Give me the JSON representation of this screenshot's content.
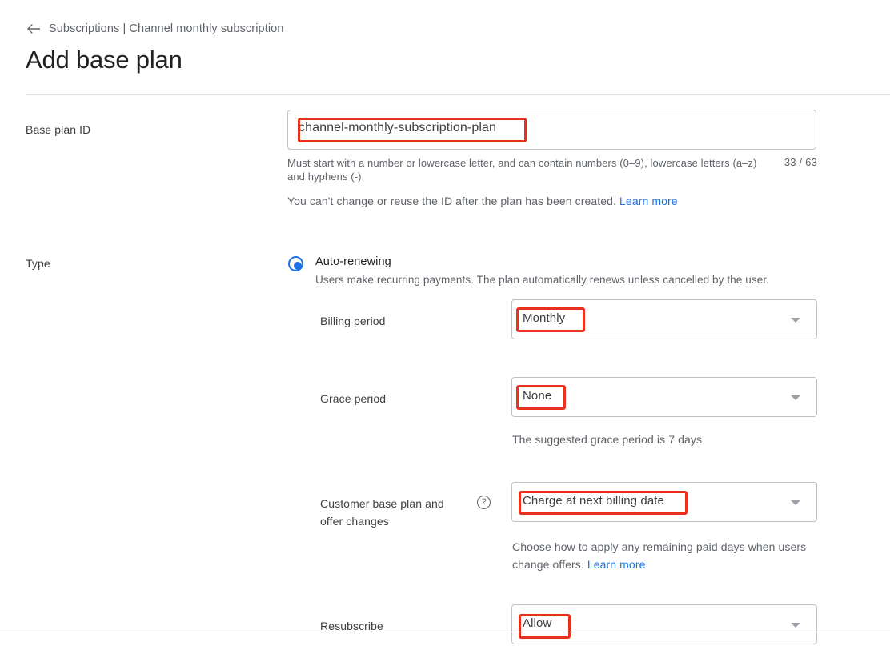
{
  "header": {
    "back_icon": "arrow-left-icon",
    "breadcrumb": "Subscriptions | Channel monthly subscription",
    "title": "Add base plan"
  },
  "form": {
    "base_plan_id": {
      "label": "Base plan ID",
      "value": "channel-monthly-subscription-plan",
      "placeholder": "",
      "helper": "Must start with a number or lowercase letter, and can contain numbers (0–9), lowercase letters (a–z) and hyphens (-)",
      "counter": "33 / 63",
      "note": "You can't change or reuse the ID after the plan has been created.",
      "note_link": "Learn more"
    },
    "type": {
      "label": "Type",
      "radio": {
        "icon": "radio-selected-icon",
        "title": "Auto-renewing",
        "description": "Users make recurring payments. The plan automatically renews unless cancelled by the user.",
        "checked": true
      }
    },
    "billing_period": {
      "label": "Billing period",
      "value": "Monthly",
      "arrow_icon": "chevron-down-icon"
    },
    "grace_period": {
      "label": "Grace period",
      "value": "None",
      "arrow_icon": "chevron-down-icon",
      "helper": "The suggested grace period is 7 days"
    },
    "customer_changes": {
      "label": "Customer base plan and offer changes",
      "help_icon": "help-circle-icon",
      "help_glyph": "?",
      "value": "Charge at next billing date",
      "arrow_icon": "chevron-down-icon",
      "helper": "Choose how to apply any remaining paid days when users change offers.",
      "helper_link": "Learn more"
    },
    "resubscribe": {
      "label": "Resubscribe",
      "value": "Allow",
      "arrow_icon": "chevron-down-icon"
    }
  },
  "annotations": {
    "color": "#e8301a",
    "targets": [
      "base-plan-id-value",
      "billing-period-value",
      "grace-period-value",
      "customer-changes-value",
      "resubscribe-value"
    ]
  }
}
